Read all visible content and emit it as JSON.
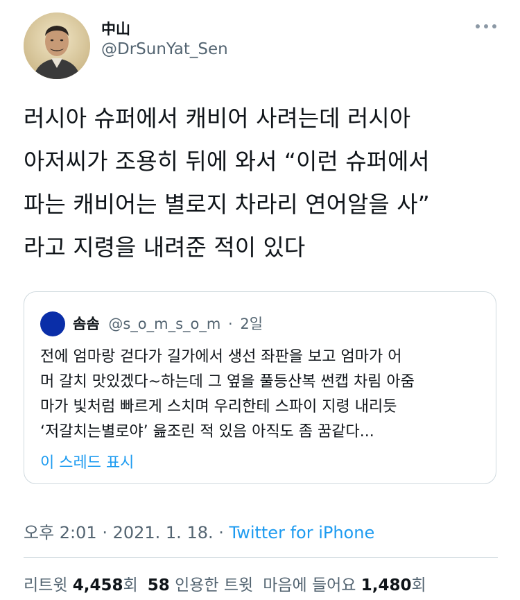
{
  "author": {
    "name": "中山",
    "handle": "@DrSunYat_Sen"
  },
  "tweet": {
    "text": "러시아 슈퍼에서 캐비어 사려는데 러시아\n아저씨가 조용히 뒤에 와서 “이런 슈퍼에서\n파는 캐비어는 별로지 차라리 연어알을 사”\n라고 지령을 내려준 적이 있다"
  },
  "quoted": {
    "name": "솜솜",
    "handle": "@s_o_m_s_o_m",
    "separator": "·",
    "time": "2일",
    "text": "전에 엄마랑 걷다가 길가에서 생선 좌판을 보고 엄마가 어\n머 갈치 맛있겠다~하는데 그 옆을 풀등산복 썬캡 차림 아줌\n마가 빛처럼 빠르게 스치며 우리한테 스파이 지령 내리듯\n‘저갈치는별로야’ 읊조린 적 있음 아직도 좀 꿈같다...",
    "show_thread": "이 스레드 표시",
    "avatar_color": "#0a2ea8"
  },
  "meta": {
    "time": "오후 2:01",
    "sep1": " · ",
    "date": "2021. 1. 18.",
    "sep2": " · ",
    "source": "Twitter for iPhone"
  },
  "stats": {
    "retweets_label": "리트윗",
    "retweets_count": "4,458",
    "retweets_unit": "회",
    "quotes_count": "58",
    "quotes_label": "인용한 트윗",
    "likes_label": "마음에 들어요",
    "likes_count": "1,480",
    "likes_unit": "회"
  },
  "colors": {
    "accent": "#1d9bf0",
    "secondary_text": "#536471",
    "border": "#cfd9de"
  },
  "icons": {
    "more": "more-horizontal-icon"
  }
}
